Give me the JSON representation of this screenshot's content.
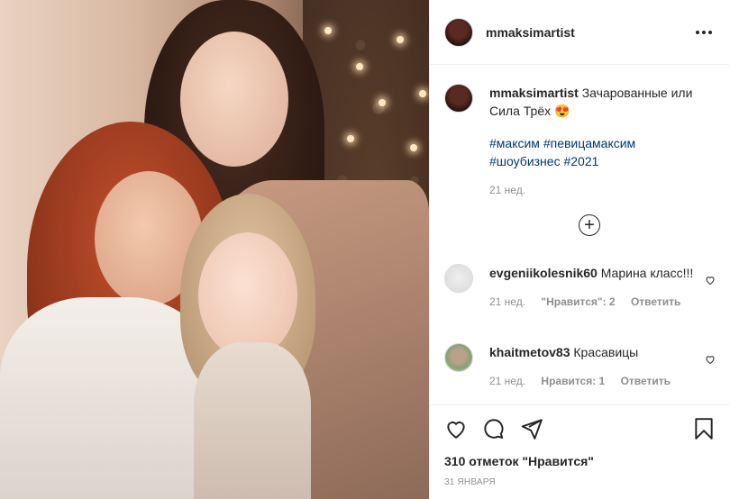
{
  "post": {
    "username": "mmaksimartist",
    "more_label": "",
    "caption": {
      "username": "mmaksimartist",
      "text": "Зачарованные или Сила Трёх 😍",
      "hashtags": [
        "#максим",
        "#певицамаксим",
        "#шоубизнес",
        "#2021"
      ],
      "time": "21 нед."
    },
    "add_more_icon": "plus-circle-icon",
    "comments": [
      {
        "username": "evgeniikolesnik60",
        "text": "Марина класс!!!",
        "time": "21 нед.",
        "likes": "\"Нравится\": 2",
        "reply": "Ответить"
      },
      {
        "username": "khaitmetov83",
        "text": "Красавицы",
        "time": "21 нед.",
        "likes": "Нравится: 1",
        "reply": "Ответить"
      }
    ],
    "likes_count": "310 отметок \"Нравится\"",
    "date": "31 ЯНВАРЯ",
    "icons": [
      "heart-icon",
      "comment-icon",
      "share-icon",
      "bookmark-icon"
    ]
  }
}
